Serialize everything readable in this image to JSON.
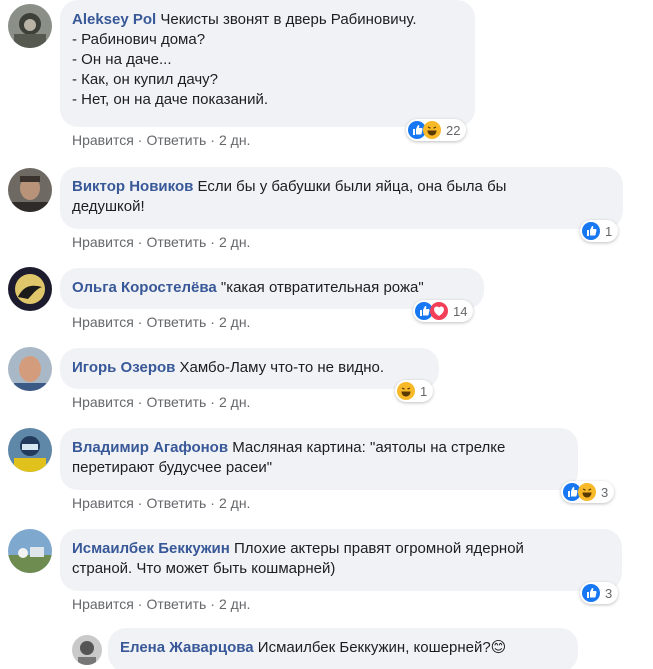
{
  "comments": [
    {
      "author": "Aleksey Pol",
      "lines": [
        "Чекисты звонят в дверь Рабиновичу.",
        "- Рабинович дома?",
        "- Он на даче...",
        "- Как, он купил дачу?",
        "- Нет, он на даче показаний."
      ],
      "like_label": "Нравится",
      "reply_label": "Ответить",
      "time": "2 дн.",
      "reaction_count": "22"
    },
    {
      "author": "Виктор Новиков",
      "lines": [
        "Если бы у бабушки были яйца, она была бы",
        "дедушкой!"
      ],
      "like_label": "Нравится",
      "reply_label": "Ответить",
      "time": "2 дн.",
      "reaction_count": "1"
    },
    {
      "author": "Ольга Коростелёва",
      "lines": [
        "\"какая отвратительная рожа\""
      ],
      "like_label": "Нравится",
      "reply_label": "Ответить",
      "time": "2 дн.",
      "reaction_count": "14"
    },
    {
      "author": "Игорь Озеров",
      "lines": [
        "Хамбо-Ламу что-то не видно."
      ],
      "like_label": "Нравится",
      "reply_label": "Ответить",
      "time": "2 дн.",
      "reaction_count": "1"
    },
    {
      "author": "Владимир Агафонов",
      "lines": [
        "Масляная картина: \"аятолы на стрелке",
        "перетирают будусчее расеи\""
      ],
      "like_label": "Нравится",
      "reply_label": "Ответить",
      "time": "2 дн.",
      "reaction_count": "3"
    },
    {
      "author": "Исмаилбек Беккужин",
      "lines": [
        "Плохие актеры правят огромной ядерной",
        "страной. Что может быть кошмарней)"
      ],
      "like_label": "Нравится",
      "reply_label": "Ответить",
      "time": "2 дн.",
      "reaction_count": "3"
    },
    {
      "author": "Елена Жаварцова",
      "lines": [
        "Исмаилбек Беккужин, кошерней?😊"
      ]
    }
  ],
  "separator": "·",
  "colors": {
    "author": "#385898",
    "bubble": "#f0f2f5",
    "meta": "#65676b",
    "like": "#1877f2",
    "haha": "#f7b928",
    "love": "#f33e58"
  }
}
